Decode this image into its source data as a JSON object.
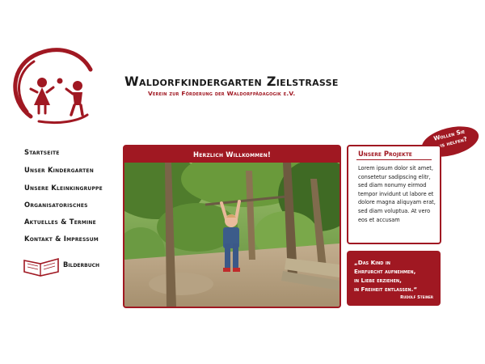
{
  "header": {
    "title": "Waldorfkindergarten Zielstrasse",
    "subtitle": "Verein zur Förderung der Waldorfpädagogik e.V."
  },
  "nav": {
    "items": [
      {
        "label": "Startseite"
      },
      {
        "label": "Unser Kindergarten"
      },
      {
        "label": "Unsere Kleinkingruppe"
      },
      {
        "label": "Organisatorisches"
      },
      {
        "label": "Aktuelles & Termine"
      },
      {
        "label": "Kontakt & Impressum"
      }
    ],
    "bilderbuch": "Bilderbuch"
  },
  "main": {
    "heading": "Herzlich Willkommen!"
  },
  "projects": {
    "title": "Unsere Projekte",
    "text": "Lorem ipsum dolor sit amet, consetetur sadipscing elitr, sed diam nonumy eirmod tempor invidunt ut labore et dolore magna aliquyam erat, sed diam voluptua. At vero eos et accusam"
  },
  "help_badge": {
    "line1": "Wollen Sie",
    "line2": "uns helfen?"
  },
  "quote": {
    "text": "„Das Kind in\nEhrfurcht aufnehmen,\nin Liebe erziehen,\nin Freiheit entlassen.“",
    "author": "Rudolf Steiner"
  },
  "colors": {
    "accent": "#a01822",
    "text": "#1a1a1a",
    "background": "#ffffff"
  },
  "icons": {
    "logo": "children-playing-ball-logo",
    "book": "open-book-icon"
  }
}
